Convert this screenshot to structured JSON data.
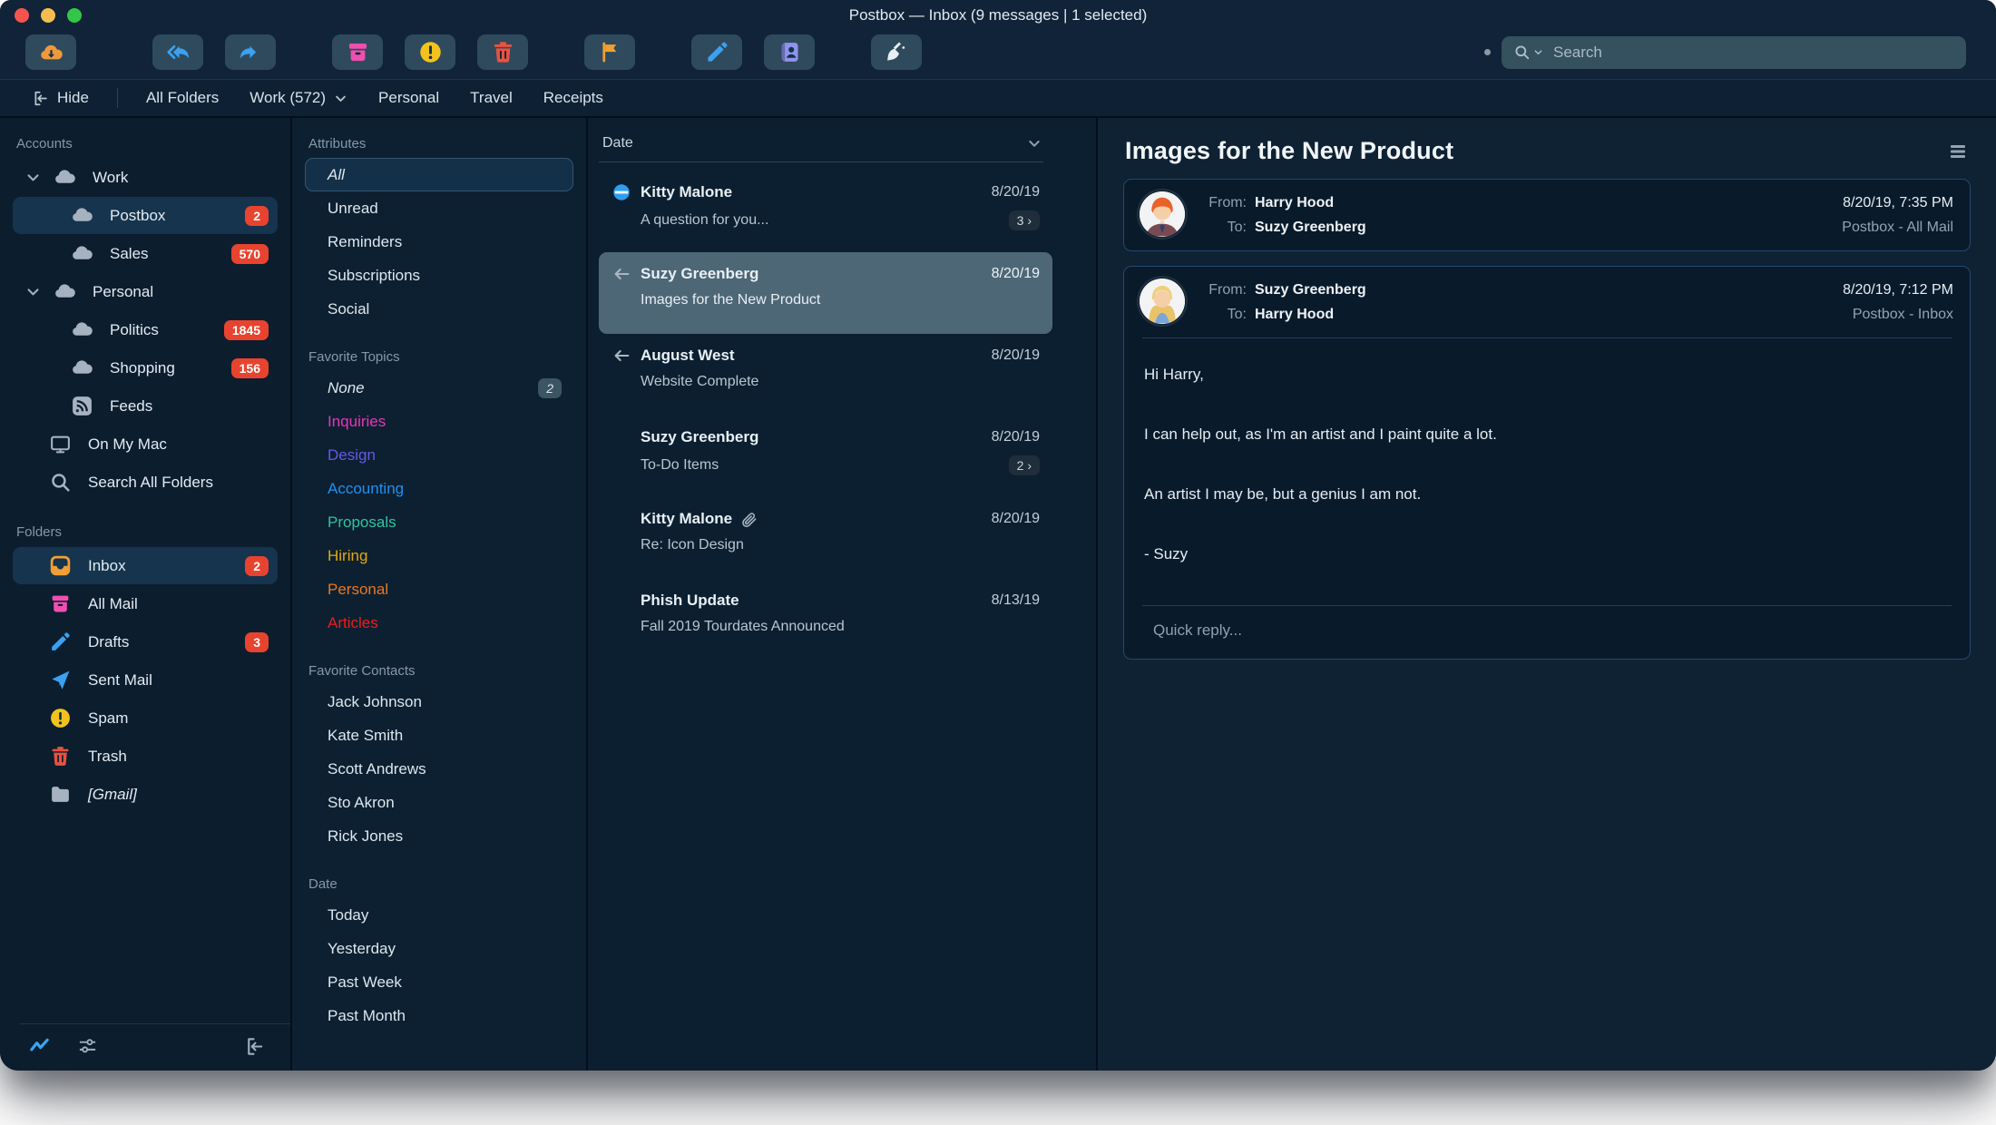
{
  "window": {
    "title": "Postbox — Inbox (9 messages | 1 selected)"
  },
  "toolbar": {
    "icons": [
      "get-mail",
      "reply-all",
      "forward",
      "archive",
      "mark-spam",
      "delete",
      "flag",
      "compose",
      "address-book",
      "sweep"
    ],
    "search": {
      "placeholder": "Search"
    }
  },
  "filterbar": {
    "hide": "Hide",
    "tabs": [
      "All Folders",
      "Work (572)",
      "Personal",
      "Travel",
      "Receipts"
    ]
  },
  "sidebar": {
    "accounts_header": "Accounts",
    "accounts": [
      {
        "label": "Work"
      },
      {
        "label": "Postbox",
        "badge": "2"
      },
      {
        "label": "Sales",
        "badge": "570"
      },
      {
        "label": "Personal"
      },
      {
        "label": "Politics",
        "badge": "1845"
      },
      {
        "label": "Shopping",
        "badge": "156"
      },
      {
        "label": "Feeds"
      },
      {
        "label": "On My Mac"
      },
      {
        "label": "Search All Folders"
      }
    ],
    "folders_header": "Folders",
    "folders": [
      {
        "label": "Inbox",
        "badge": "2"
      },
      {
        "label": "All Mail"
      },
      {
        "label": "Drafts",
        "badge": "3"
      },
      {
        "label": "Sent Mail"
      },
      {
        "label": "Spam"
      },
      {
        "label": "Trash"
      },
      {
        "label": "[Gmail]"
      }
    ]
  },
  "filters": {
    "attributes_header": "Attributes",
    "attributes": [
      "All",
      "Unread",
      "Reminders",
      "Subscriptions",
      "Social"
    ],
    "topics_header": "Favorite Topics",
    "topics": [
      {
        "label": "None",
        "badge": "2",
        "color": "#dde7ee"
      },
      {
        "label": "Inquiries",
        "color": "#e637b8"
      },
      {
        "label": "Design",
        "color": "#6658e8"
      },
      {
        "label": "Accounting",
        "color": "#1e90f0"
      },
      {
        "label": "Proposals",
        "color": "#2ec4a0"
      },
      {
        "label": "Hiring",
        "color": "#e0a80f"
      },
      {
        "label": "Personal",
        "color": "#e87722"
      },
      {
        "label": "Articles",
        "color": "#ed1c1c"
      }
    ],
    "contacts_header": "Favorite Contacts",
    "contacts": [
      "Jack Johnson",
      "Kate Smith",
      "Scott Andrews",
      "Sto Akron",
      "Rick Jones"
    ],
    "date_header": "Date",
    "dates": [
      "Today",
      "Yesterday",
      "Past Week",
      "Past Month"
    ]
  },
  "list": {
    "sort_label": "Date",
    "messages": [
      {
        "sender": "Kitty Malone",
        "subject": "A question for you...",
        "date": "8/20/19",
        "thread": "3 ›"
      },
      {
        "sender": "Suzy Greenberg",
        "subject": "Images for the New Product",
        "date": "8/20/19"
      },
      {
        "sender": "August West",
        "subject": "Website Complete",
        "date": "8/20/19"
      },
      {
        "sender": "Suzy Greenberg",
        "subject": "To-Do Items",
        "date": "8/20/19",
        "thread": "2 ›"
      },
      {
        "sender": "Kitty Malone",
        "subject": "Re: Icon Design",
        "date": "8/20/19"
      },
      {
        "sender": "Phish Update",
        "subject": "Fall 2019 Tourdates Announced",
        "date": "8/13/19"
      }
    ]
  },
  "reading": {
    "title": "Images for the New Product",
    "cards": [
      {
        "from_label": "From:",
        "from": "Harry Hood",
        "to_label": "To:",
        "to": "Suzy Greenberg",
        "datetime": "8/20/19, 7:35 PM",
        "folder": "Postbox - All Mail"
      },
      {
        "from_label": "From:",
        "from": "Suzy Greenberg",
        "to_label": "To:",
        "to": "Harry Hood",
        "datetime": "8/20/19, 7:12 PM",
        "folder": "Postbox - Inbox",
        "body": [
          "Hi Harry,",
          "I can help out, as I'm an artist and I paint quite a lot.",
          "An artist I may be, but a genius I am not.",
          "- Suzy"
        ],
        "quick_reply": "Quick reply..."
      }
    ]
  },
  "colors": {
    "accent_blue": "#3ba1f0",
    "badge_red": "#e8432e",
    "selection_row": "#4d6777",
    "sidebar_selection": "#16344d",
    "card_border": "#24496b",
    "window_bg": "#0c1e2f"
  }
}
